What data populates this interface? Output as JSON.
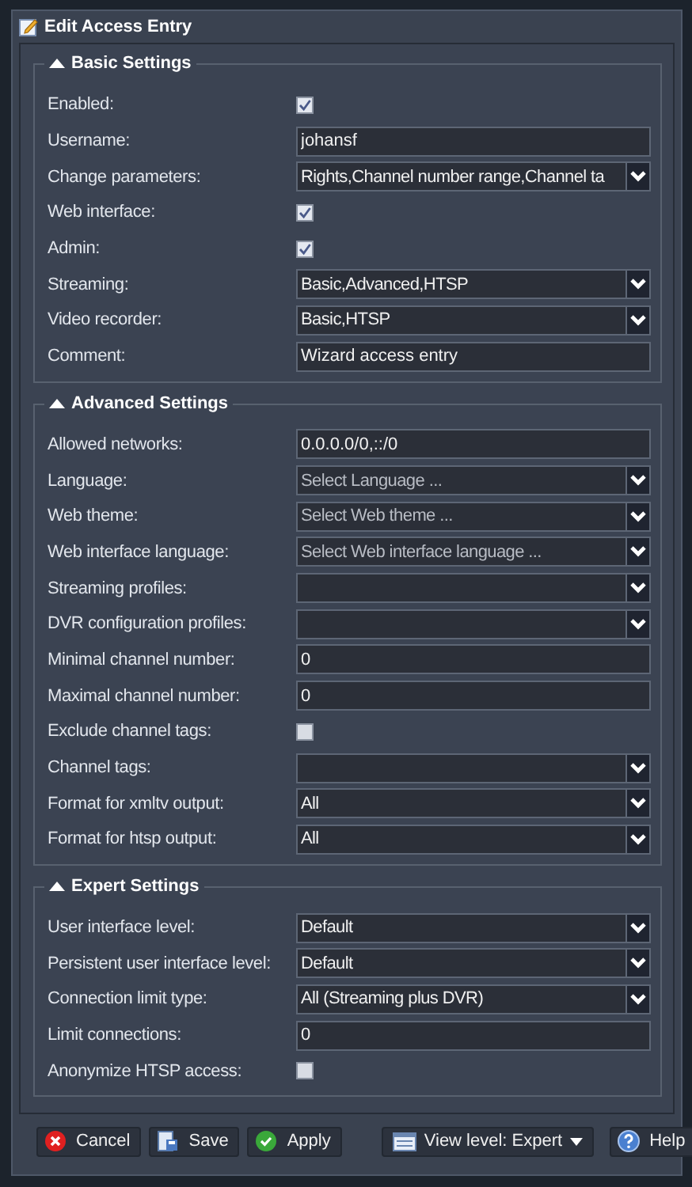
{
  "window": {
    "title": "Edit Access Entry"
  },
  "sections": [
    {
      "title": "Basic Settings",
      "expanded": true,
      "fields": [
        {
          "label": "Enabled:",
          "kind": "checkbox",
          "checked": true
        },
        {
          "label": "Username:",
          "kind": "text",
          "value": "johansf"
        },
        {
          "label": "Change parameters:",
          "kind": "combo",
          "value": "Rights,Channel number range,Channel ta"
        },
        {
          "label": "Web interface:",
          "kind": "checkbox",
          "checked": true
        },
        {
          "label": "Admin:",
          "kind": "checkbox",
          "checked": true
        },
        {
          "label": "Streaming:",
          "kind": "combo",
          "value": "Basic,Advanced,HTSP"
        },
        {
          "label": "Video recorder:",
          "kind": "combo",
          "value": "Basic,HTSP"
        },
        {
          "label": "Comment:",
          "kind": "text",
          "value": "Wizard access entry"
        }
      ]
    },
    {
      "title": "Advanced Settings",
      "expanded": true,
      "fields": [
        {
          "label": "Allowed networks:",
          "kind": "text",
          "value": "0.0.0.0/0,::/0"
        },
        {
          "label": "Language:",
          "kind": "combo",
          "placeholder": "Select Language ..."
        },
        {
          "label": "Web theme:",
          "kind": "combo",
          "placeholder": "Select Web theme ..."
        },
        {
          "label": "Web interface language:",
          "kind": "combo",
          "placeholder": "Select Web interface language ..."
        },
        {
          "label": "Streaming profiles:",
          "kind": "combo"
        },
        {
          "label": "DVR configuration profiles:",
          "kind": "combo"
        },
        {
          "label": "Minimal channel number:",
          "kind": "text",
          "value": "0"
        },
        {
          "label": "Maximal channel number:",
          "kind": "text",
          "value": "0"
        },
        {
          "label": "Exclude channel tags:",
          "kind": "checkbox",
          "checked": false
        },
        {
          "label": "Channel tags:",
          "kind": "combo"
        },
        {
          "label": "Format for xmltv output:",
          "kind": "combo",
          "value": "All"
        },
        {
          "label": "Format for htsp output:",
          "kind": "combo",
          "value": "All"
        }
      ]
    },
    {
      "title": "Expert Settings",
      "expanded": true,
      "fields": [
        {
          "label": "User interface level:",
          "kind": "combo",
          "value": "Default"
        },
        {
          "label": "Persistent user interface level:",
          "kind": "combo",
          "value": "Default"
        },
        {
          "label": "Connection limit type:",
          "kind": "combo",
          "value": "All (Streaming plus DVR)"
        },
        {
          "label": "Limit connections:",
          "kind": "text",
          "value": "0"
        },
        {
          "label": "Anonymize HTSP access:",
          "kind": "checkbox",
          "checked": false
        }
      ]
    }
  ],
  "buttons": [
    {
      "label": "Cancel",
      "kind": "cancel"
    },
    {
      "label": "Save",
      "kind": "save"
    },
    {
      "label": "Apply",
      "kind": "apply"
    },
    {
      "label": "View level: Expert",
      "kind": "menu"
    },
    {
      "label": "Help",
      "kind": "help"
    }
  ]
}
